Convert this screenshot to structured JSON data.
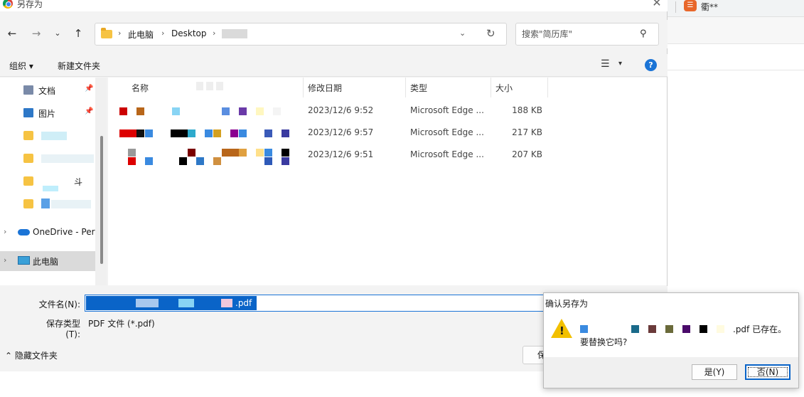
{
  "dialog": {
    "title": "另存为",
    "close_glyph": "✕"
  },
  "nav": {
    "back": "←",
    "forward": "→",
    "recent": "⌄",
    "up": "↑",
    "breadcrumb": [
      "此电脑",
      "Desktop"
    ],
    "breadcrumb_sep": "›",
    "dropdown_glyph": "⌄",
    "refresh_glyph": "↻"
  },
  "search": {
    "placeholder": "搜索\"简历库\"",
    "icon_glyph": "⚲"
  },
  "commands": {
    "organize": "组织 ▾",
    "new_folder": "新建文件夹",
    "view_glyph": "☰",
    "view_dd": "▾",
    "help": "?"
  },
  "sidebar": {
    "items": [
      {
        "label": "文档",
        "pinned": true
      },
      {
        "label": "图片",
        "pinned": true
      },
      {
        "label": ""
      },
      {
        "label": ""
      },
      {
        "label": "斗"
      },
      {
        "label": ""
      },
      {
        "label": "OneDrive - Pers"
      },
      {
        "label": "此电脑"
      }
    ],
    "pin_glyph": "📌",
    "expand_glyph": "›"
  },
  "table": {
    "headers": [
      "名称",
      "修改日期",
      "类型",
      "大小"
    ],
    "rows": [
      {
        "modified": "2023/12/6 9:52",
        "type": "Microsoft Edge ...",
        "size": "188 KB"
      },
      {
        "modified": "2023/12/6 9:57",
        "type": "Microsoft Edge ...",
        "size": "217 KB"
      },
      {
        "modified": "2023/12/6 9:51",
        "type": "Microsoft Edge ...",
        "size": "207 KB"
      }
    ]
  },
  "fields": {
    "filename_label": "文件名(N):",
    "filename_suffix": ".pdf",
    "filetype_label": "保存类型(T):",
    "filetype_value": "PDF 文件 (*.pdf)",
    "hide_folders": "⌃ 隐藏文件夹",
    "save_partial": "保"
  },
  "confirm": {
    "title": "确认另存为",
    "line1_suffix": ".pdf 已存在。",
    "line2": "要替换它吗?",
    "yes": "是(Y)",
    "no": "否(N)",
    "warn_glyph": "!"
  },
  "browser_bg": {
    "tab_label": "衢**",
    "tab_icon": "☰"
  },
  "colors": {
    "accent": "#0a64c8",
    "warning": "#f2c000",
    "help": "#1b74d6"
  }
}
